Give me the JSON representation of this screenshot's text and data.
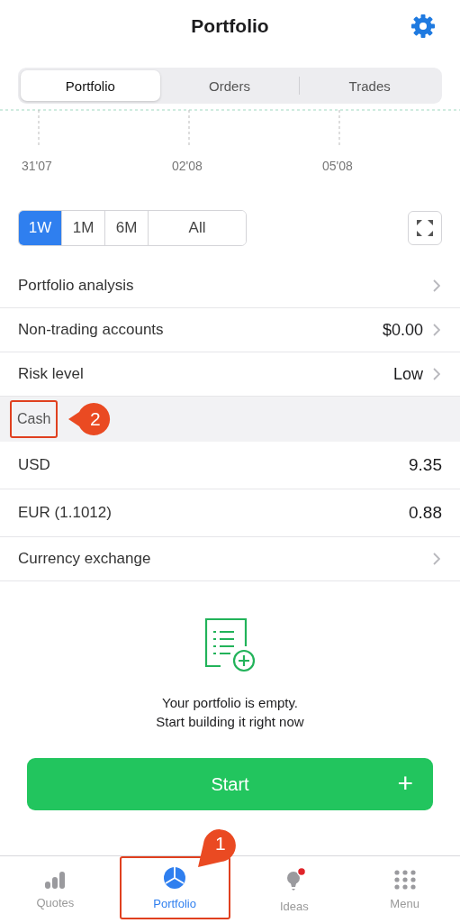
{
  "header": {
    "title": "Portfolio"
  },
  "segments": [
    {
      "label": "Portfolio",
      "selected": true
    },
    {
      "label": "Orders",
      "selected": false
    },
    {
      "label": "Trades",
      "selected": false
    }
  ],
  "chart": {
    "x_labels": [
      "31'07",
      "02'08",
      "05'08"
    ]
  },
  "periods": [
    {
      "label": "1W",
      "selected": true
    },
    {
      "label": "1M",
      "selected": false
    },
    {
      "label": "6M",
      "selected": false
    },
    {
      "label": "All",
      "selected": false
    }
  ],
  "rows": [
    {
      "label": "Portfolio analysis"
    },
    {
      "label": "Non-trading accounts",
      "value": "$0.00"
    },
    {
      "label": "Risk level",
      "value": "Low"
    }
  ],
  "cash": {
    "title": "Cash",
    "annotation": "2",
    "rows": [
      {
        "label": "USD",
        "value": "9.35"
      },
      {
        "label": "EUR (1.1012)",
        "value": "0.88"
      }
    ]
  },
  "exchange_row": {
    "label": "Currency exchange"
  },
  "empty_state": {
    "line1": "Your portfolio is empty.",
    "line2": "Start building it right now"
  },
  "start_button": {
    "label": "Start",
    "icon": "+"
  },
  "tab_bar": [
    {
      "label": "Quotes",
      "selected": false,
      "kind": "bars"
    },
    {
      "label": "Portfolio",
      "selected": true,
      "kind": "pie",
      "annotation": "1"
    },
    {
      "label": "Ideas",
      "selected": false,
      "kind": "bulb",
      "badge": true
    },
    {
      "label": "Menu",
      "selected": false,
      "kind": "grid"
    }
  ]
}
